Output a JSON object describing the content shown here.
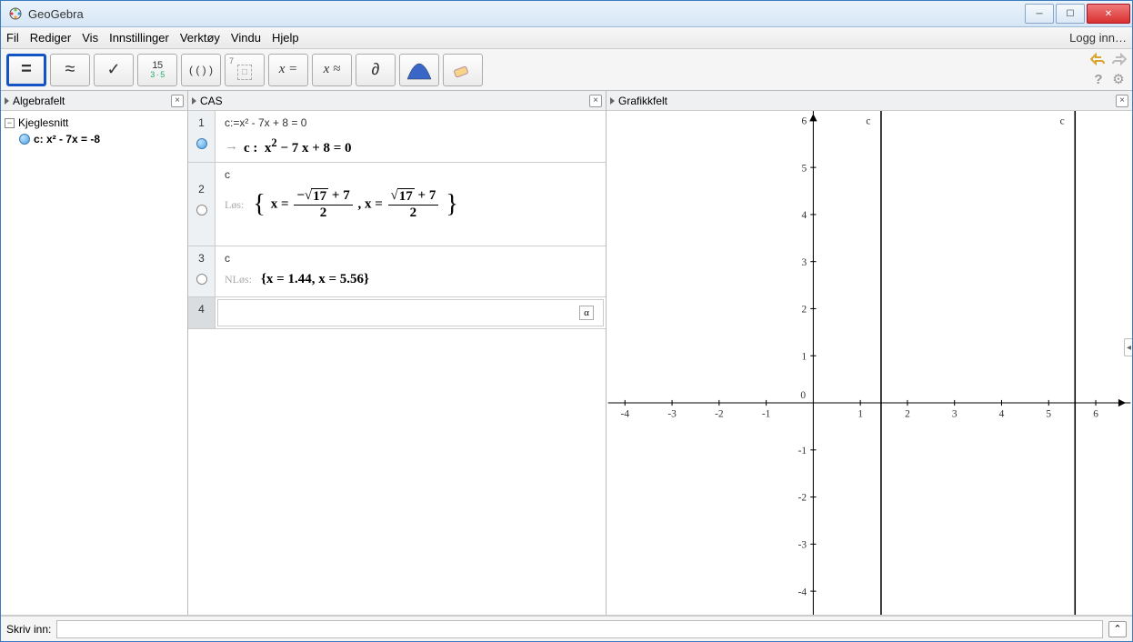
{
  "title": "GeoGebra",
  "menus": [
    "Fil",
    "Rediger",
    "Vis",
    "Innstillinger",
    "Verktøy",
    "Vindu",
    "Hjelp"
  ],
  "login": "Logg inn…",
  "toolbar": [
    {
      "name": "evaluate",
      "label": "=",
      "selected": true
    },
    {
      "name": "approx",
      "label": "≈"
    },
    {
      "name": "keep-input",
      "label": "✓"
    },
    {
      "name": "factor",
      "label": "15",
      "sub": "3 · 5"
    },
    {
      "name": "expand",
      "label": "( ( ) )"
    },
    {
      "name": "substitute",
      "label": "",
      "sup": "7",
      "main": "□"
    },
    {
      "name": "solve",
      "label": "x =",
      "italic": true
    },
    {
      "name": "nsolve",
      "label": "x ≈",
      "italic": true
    },
    {
      "name": "derivative",
      "label": "∂"
    },
    {
      "name": "probability",
      "svg": "normal"
    },
    {
      "name": "delete",
      "svg": "eraser"
    }
  ],
  "panels": {
    "algebra": {
      "title": "Algebrafelt",
      "group": "Kjeglesnitt",
      "item": "c: x² - 7x = -8"
    },
    "cas": {
      "title": "CAS",
      "rows": [
        {
          "num": "1",
          "filled": true,
          "input": "c:=x² - 7x + 8 = 0",
          "arrow": "→",
          "out": "c : x² − 7 x + 8 = 0"
        },
        {
          "num": "2",
          "filled": false,
          "input": "c",
          "prefix": "Løs:",
          "roots": [
            "(−√17 + 7)/2",
            "(√17 + 7)/2"
          ]
        },
        {
          "num": "3",
          "filled": false,
          "input": "c",
          "prefix": "NLøs:",
          "out": "{x = 1.44, x = 5.56}"
        },
        {
          "num": "4",
          "empty": true
        }
      ]
    },
    "graphics": {
      "title": "Grafikkfelt",
      "xlines": [
        1.44,
        5.56
      ],
      "label": "c"
    }
  },
  "inputbar_label": "Skriv inn:"
}
